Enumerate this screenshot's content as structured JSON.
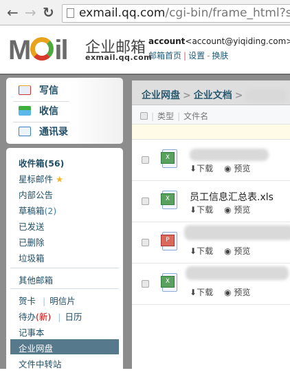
{
  "browser": {
    "url_host": "exmail.qq.com",
    "url_path": "/cgi-bin/frame_html?sid=",
    "back": "←",
    "forward": "→",
    "reload": "↻"
  },
  "header": {
    "logo_text": "M il",
    "brand": "企业邮箱",
    "brand_sub": "exmail.qq.com",
    "account_name": "account",
    "account_email": "<account@yiqiding.com>",
    "links": [
      "邮箱首页",
      "设置",
      "换肤"
    ],
    "link_sep1": "|",
    "link_sep2": "-"
  },
  "actions": [
    {
      "label": "写信",
      "icon": "compose-icon"
    },
    {
      "label": "收信",
      "icon": "receive-icon"
    },
    {
      "label": "通讯录",
      "icon": "contacts-icon"
    }
  ],
  "folders": {
    "inbox": "收件箱(56)",
    "starred": "星标邮件",
    "starred_icon": "★",
    "announce": "内部公告",
    "drafts": "草稿箱",
    "drafts_count": "(2)",
    "sent": "已发送",
    "deleted": "已删除",
    "junk": "垃圾箱",
    "other": "其他邮箱",
    "cards": "贺卡",
    "postcards": "明信片",
    "todo": "待办",
    "todo_new": "(新)",
    "calendar": "日历",
    "notes": "记事本",
    "netdisk": "企业网盘",
    "transfer": "文件中转站",
    "sep": "|"
  },
  "main": {
    "breadcrumb": [
      "企业网盘",
      "企业文档"
    ],
    "crumb_sep": ">",
    "columns": [
      "类型",
      "文件名"
    ],
    "files": [
      {
        "type": "xls",
        "name": ""
      },
      {
        "type": "xls",
        "name": "员工信息汇总表.xls"
      },
      {
        "type": "ppt",
        "name": ""
      },
      {
        "type": "xls",
        "name": ""
      }
    ],
    "download": "下载",
    "preview": "预览"
  },
  "colors": {
    "selected": "#57798c",
    "link": "#1f4e66",
    "new": "#cc0000"
  }
}
